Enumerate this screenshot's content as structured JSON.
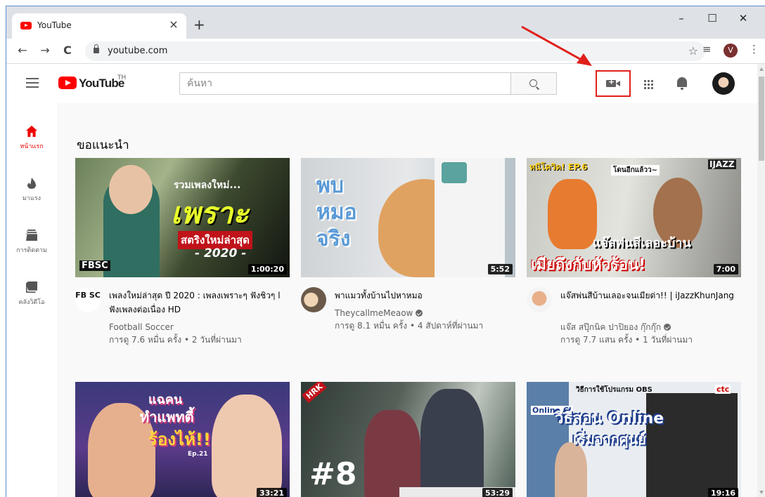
{
  "browser": {
    "tab_title": "YouTube",
    "tab_close": "×",
    "new_tab": "+",
    "url": "youtube.com",
    "win_min": "–",
    "win_max": "☐",
    "win_close": "✕",
    "nav_back": "←",
    "nav_forward": "→",
    "nav_reload": "C",
    "star": "☆",
    "menu": "⋮",
    "media": "≡",
    "profile_letter": "V"
  },
  "header": {
    "logo_text": "YouTube",
    "region": "TH",
    "search_placeholder": "ค้นหา"
  },
  "sidebar": {
    "items": [
      {
        "label": "หน้าแรก",
        "icon": "home-icon"
      },
      {
        "label": "มาแรง",
        "icon": "trending-icon"
      },
      {
        "label": "การติดตาม",
        "icon": "subscriptions-icon"
      },
      {
        "label": "คลังวิดีโอ",
        "icon": "library-icon"
      }
    ]
  },
  "main": {
    "section_title": "ขอแนะนำ",
    "videos": [
      {
        "title": "เพลงใหม่ล่าสุด ปี 2020 : เพลงเพราะๆ ฟังชิวๆ l ฟังเพลงต่อเนื่อง HD",
        "channel": "Football Soccer",
        "stats": "การดู 7.6 หมื่น ครั้ง • 2 วันที่ผ่านมา",
        "duration": "1:00:20",
        "verified": false,
        "thumb_top": "รวมเพลงใหม่...",
        "thumb_big": "เพราะ",
        "thumb_sub": "สตริงใหม่ล่าสุด",
        "thumb_year": "- 2020 -",
        "thumb_brand": "FBSC",
        "avatar_text": "FB SC"
      },
      {
        "title": "พาแมวทั้งบ้านไปหาหมอ",
        "channel": "TheycallmeMeaow",
        "stats": "การดู 8.1 หมื่น ครั้ง • 4 สัปดาห์ที่ผ่านมา",
        "duration": "5:52",
        "verified": true,
        "thumb_text": [
          "พบ",
          "หมอ",
          "จริง"
        ]
      },
      {
        "title": "แจ๊สพ่นสีบ้านเลอะจนเมียด่า!! | iJazzKhunJang",
        "channel": "แจ๊ส สปุ๊กนิค ปาปิยอง กุ๊กกุ๊ก",
        "stats": "การดู 7.7 แสน ครั้ง • 1 วันที่ผ่านมา",
        "duration": "7:00",
        "verified": true,
        "thumb_top": "หนีโควิด! EP.6",
        "thumb_bubble": "โดนอีกแล้วว~",
        "thumb_brand": "IJAZZ",
        "thumb_line1": "แจ๊สพ่นสีเลอะบ้าน",
        "thumb_line2": "เมียถึงกับหัวร้อน!"
      },
      {
        "duration": "33:21",
        "thumb_text": [
          "แฉคน",
          "ทำแพทตี้",
          "ร้องไห้!!"
        ],
        "thumb_ep": "Ep.21"
      },
      {
        "duration": "53:29",
        "thumb_badge": "HRK",
        "thumb_num": "#8"
      },
      {
        "duration": "19:16",
        "thumb_header": "วิธีการใช้โปรแกรม OBS",
        "thumb_logo": "ctc",
        "thumb_online": "Online Cl",
        "thumb_line1": "วิธีสอน Online",
        "thumb_line2": "เริ่มจากศูนย์"
      }
    ]
  },
  "colors": {
    "brand_red": "#ff0000",
    "annotation_red": "#e0201b"
  }
}
